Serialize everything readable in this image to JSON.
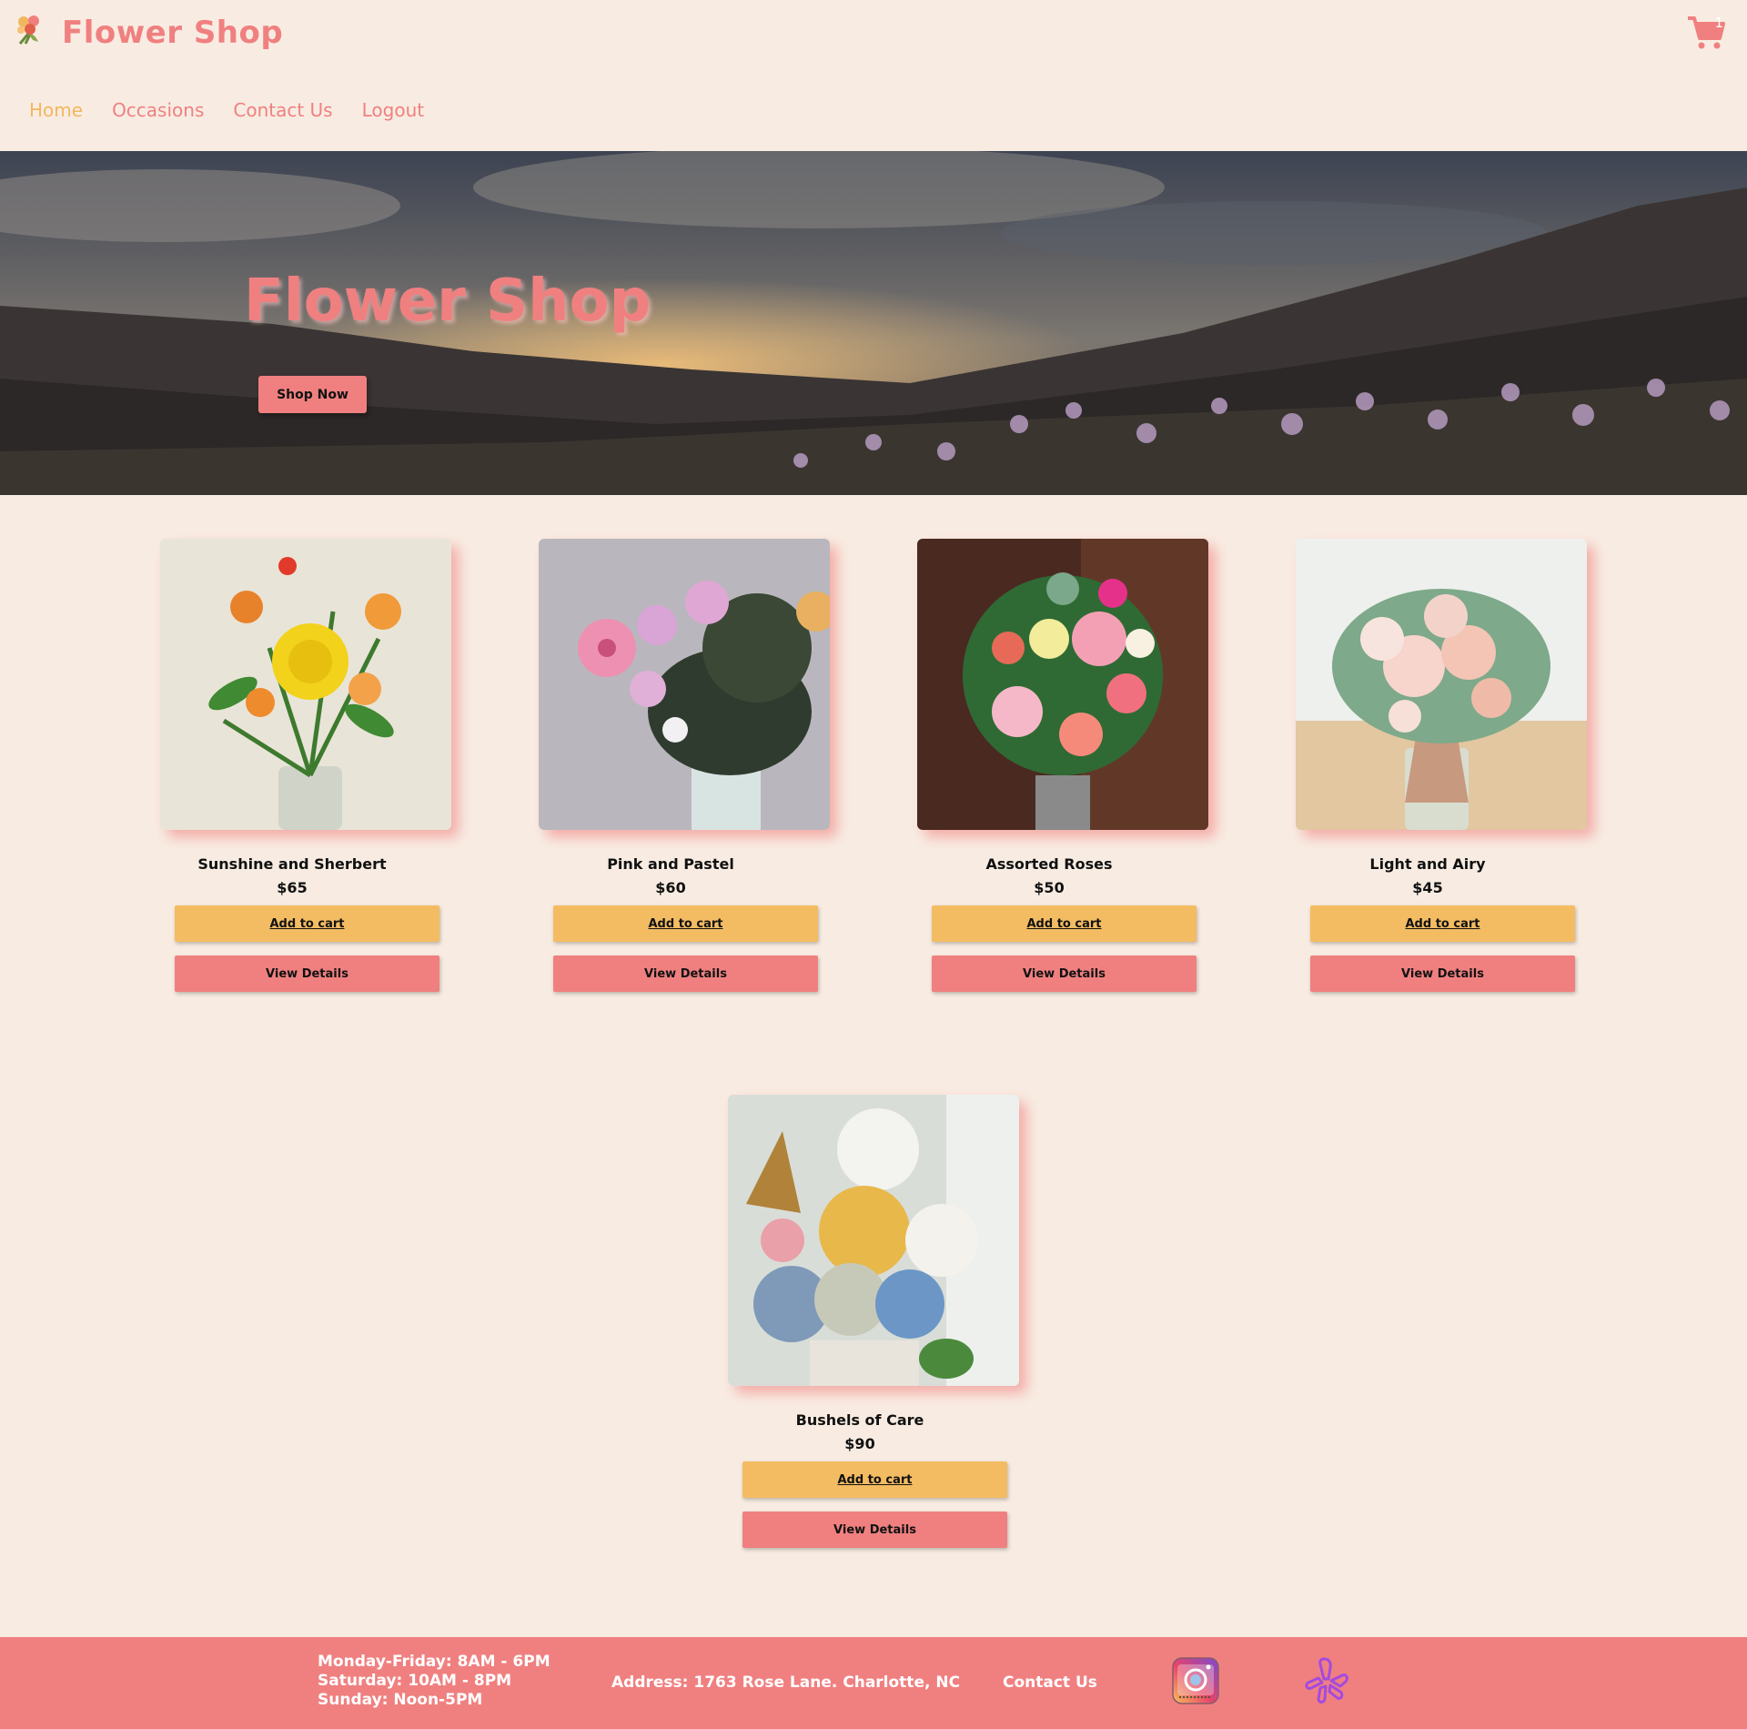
{
  "header": {
    "brand": "Flower Shop",
    "logo_icon": "bouquet-icon",
    "cart_icon": "cart-icon",
    "cart_count": "1"
  },
  "nav": {
    "items": [
      {
        "label": "Home",
        "active": true
      },
      {
        "label": "Occasions",
        "active": false
      },
      {
        "label": "Contact Us",
        "active": false
      },
      {
        "label": "Logout",
        "active": false
      }
    ]
  },
  "hero": {
    "title": "Flower Shop",
    "cta_label": "Shop Now"
  },
  "products": [
    {
      "name": "Sunshine and Sherbert",
      "price": "$65",
      "add_label": "Add to cart",
      "view_label": "View Details"
    },
    {
      "name": "Pink and Pastel",
      "price": "$60",
      "add_label": "Add to cart",
      "view_label": "View Details"
    },
    {
      "name": "Assorted Roses",
      "price": "$50",
      "add_label": "Add to cart",
      "view_label": "View Details"
    },
    {
      "name": "Light and Airy",
      "price": "$45",
      "add_label": "Add to cart",
      "view_label": "View Details"
    },
    {
      "name": "Bushels of Care",
      "price": "$90",
      "add_label": "Add to cart",
      "view_label": "View Details"
    }
  ],
  "footer": {
    "hours": [
      "Monday-Friday: 8AM - 6PM",
      "Saturday: 10AM - 8PM",
      "Sunday: Noon-5PM"
    ],
    "address": "Address: 1763 Rose Lane. Charlotte, NC",
    "contact_label": "Contact Us",
    "social": [
      "instagram-icon",
      "yelp-icon"
    ]
  },
  "colors": {
    "background": "#f8ece2",
    "brand_pink": "#f08080",
    "accent_yellow": "#f4bc62",
    "nav_active": "#f2b75e"
  }
}
